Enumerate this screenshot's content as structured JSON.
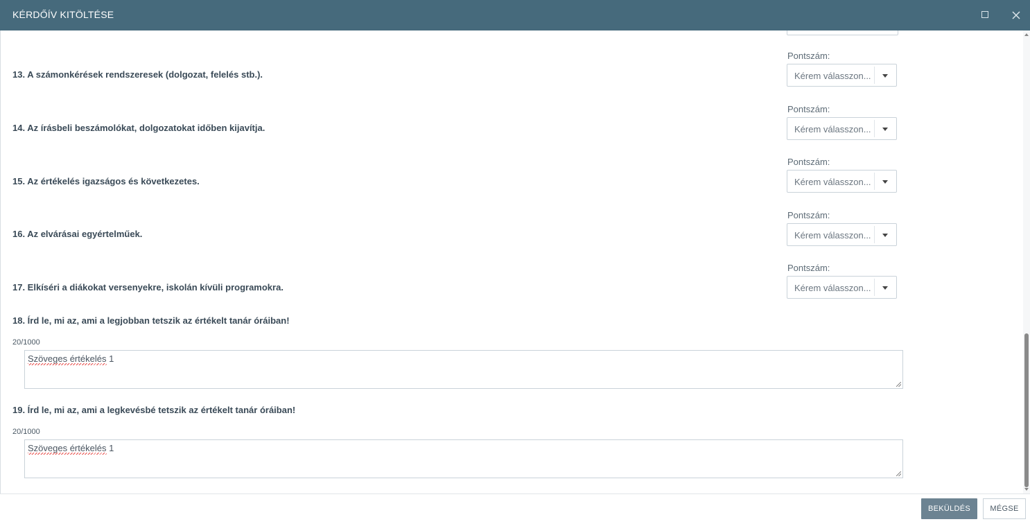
{
  "dialog": {
    "title": "KÉRDŐÍV KITÖLTÉSE"
  },
  "score_label": "Pontszám:",
  "select_placeholder": "Kérem válasszon...",
  "questions": [
    {
      "text": "13. A számonkérések rendszeresek (dolgozat, felelés stb.)."
    },
    {
      "text": "14. Az írásbeli beszámolókat, dolgozatokat időben kijavítja."
    },
    {
      "text": "15. Az értékelés igazságos és következetes."
    },
    {
      "text": "16. Az elvárásai egyértelműek."
    },
    {
      "text": "17. Elkíséri a diákokat versenyekre, iskolán kívüli programokra."
    }
  ],
  "text_questions": [
    {
      "text": "18. Írd le, mi az, ami a legjobban tetszik az értékelt tanár óráiban!",
      "counter": "20/1000",
      "value": "Szöveges értékelés 1"
    },
    {
      "text": "19. Írd le, mi az, ami a legkevésbé tetszik az értékelt tanár óráiban!",
      "counter": "20/1000",
      "value": "Szöveges értékelés 1"
    }
  ],
  "footer": {
    "submit_label": "BEKÜLDÉS",
    "cancel_label": "MÉGSE"
  },
  "colors": {
    "header": "#466a7c",
    "primary_button": "#6c8392"
  },
  "icons": {
    "maximize": "maximize-icon",
    "close": "close-icon",
    "dropdown": "caret-down-icon"
  }
}
